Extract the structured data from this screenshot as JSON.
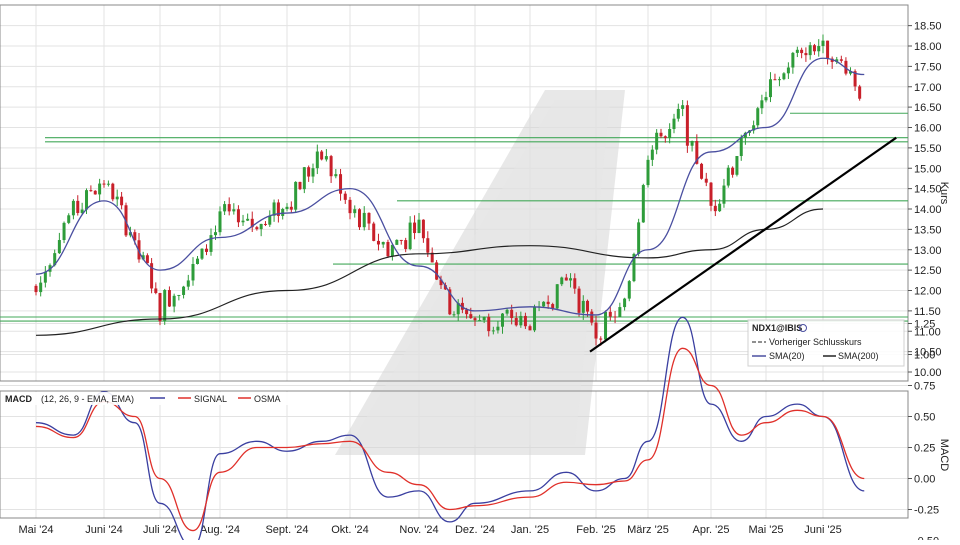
{
  "chart_data": [
    {
      "type": "candlestick",
      "ylabel": "Kurs",
      "ylim": [
        9.75,
        18.75
      ],
      "yticks": [
        "10.00",
        "10.50",
        "11.00",
        "11.50",
        "12.00",
        "12.50",
        "13.00",
        "13.50",
        "14.00",
        "14.50",
        "15.00",
        "15.50",
        "16.00",
        "16.50",
        "17.00",
        "17.50",
        "18.00",
        "18.50"
      ],
      "xticks": [
        "Mai '24",
        "Juni '24",
        "Juli '24",
        "Aug. '24",
        "Sept. '24",
        "Okt. '24",
        "Nov. '24",
        "Dez. '24",
        "Jan. '25",
        "Feb. '25",
        "März '25",
        "Apr. '25",
        "Mai '25",
        "Juni '25"
      ],
      "grid": true,
      "legend_position": "bottom-right",
      "legend": {
        "symbol": "NDX1@IBIS",
        "prev_close": "Vorheriger Schlusskurs",
        "sma20": "SMA(20)",
        "sma200": "SMA(200)"
      },
      "colors": {
        "up": "#2e9c3a",
        "down": "#c8202a",
        "sma20": "#4a4fa0",
        "sma200": "#222222",
        "levels": "#43a85a",
        "trendline": "#000000"
      },
      "horizontal_levels": [
        15.75,
        15.65,
        14.2,
        12.65,
        11.35,
        11.25,
        16.35
      ],
      "trendline": {
        "from": [
          "Feb. '25",
          10.5
        ],
        "to": [
          "Juni '25",
          15.75
        ]
      },
      "close_path": [
        [
          "Mai '24",
          12.1
        ],
        [
          "Mai '24",
          14.0
        ],
        [
          "Juni '24",
          14.7
        ],
        [
          "Juni '24",
          13.2
        ],
        [
          "Juli '24",
          11.6
        ],
        [
          "Juli '24",
          12.6
        ],
        [
          "Aug. '24",
          13.8
        ],
        [
          "Aug. '24",
          13.6
        ],
        [
          "Sept. '24",
          14.2
        ],
        [
          "Sept. '24",
          15.4
        ],
        [
          "Okt. '24",
          14.0
        ],
        [
          "Okt. '24",
          13.0
        ],
        [
          "Nov. '24",
          13.6
        ],
        [
          "Nov. '24",
          11.7
        ],
        [
          "Dez. '24",
          11.3
        ],
        [
          "Jan. '25",
          11.2
        ],
        [
          "Jan. '25",
          12.4
        ],
        [
          "Feb. '25",
          11.0
        ],
        [
          "Feb. '25",
          11.5
        ],
        [
          "März '25",
          15.5
        ],
        [
          "März '25",
          16.3
        ],
        [
          "Apr. '25",
          14.0
        ],
        [
          "Apr. '25",
          15.6
        ],
        [
          "Mai '25",
          16.8
        ],
        [
          "Mai '25",
          17.8
        ],
        [
          "Juni '25",
          18.1
        ],
        [
          "Juni '25",
          16.9
        ]
      ],
      "sma20_path": [
        [
          "Mai '24",
          12.4
        ],
        [
          "Juni '24",
          14.2
        ],
        [
          "Juli '24",
          12.5
        ],
        [
          "Aug. '24",
          13.3
        ],
        [
          "Sept. '24",
          13.9
        ],
        [
          "Okt. '24",
          14.5
        ],
        [
          "Nov. '24",
          12.6
        ],
        [
          "Dez. '24",
          11.5
        ],
        [
          "Jan. '25",
          11.6
        ],
        [
          "Feb. '25",
          11.4
        ],
        [
          "März '25",
          13.0
        ],
        [
          "Apr. '25",
          15.4
        ],
        [
          "Mai '25",
          16.0
        ],
        [
          "Juni '25",
          17.7
        ],
        [
          "Juni '25",
          17.3
        ]
      ],
      "sma200_path": [
        [
          "Mai '24",
          10.9
        ],
        [
          "Juli '24",
          11.3
        ],
        [
          "Sept. '24",
          12.0
        ],
        [
          "Nov. '24",
          12.9
        ],
        [
          "Jan. '25",
          13.1
        ],
        [
          "März '25",
          12.8
        ],
        [
          "Apr. '25",
          13.0
        ],
        [
          "Mai '25",
          13.5
        ],
        [
          "Juni '25",
          14.0
        ]
      ]
    },
    {
      "type": "line",
      "title": "MACD",
      "params": "(12, 26, 9 - EMA, EMA)",
      "ylabel": "MACD",
      "ylim": [
        -0.6,
        1.4
      ],
      "yticks": [
        "-0.50",
        "-0.25",
        "0.00",
        "0.25",
        "0.50",
        "0.75",
        "1.00",
        "1.25"
      ],
      "series": [
        {
          "name": "",
          "color": "#3a3fa0",
          "values": [
            [
              "Mai '24",
              0.45
            ],
            [
              "Mai '24",
              0.35
            ],
            [
              "Juni '24",
              0.7
            ],
            [
              "Juni '24",
              0.45
            ],
            [
              "Juli '24",
              -0.2
            ],
            [
              "Juli '24",
              -0.55
            ],
            [
              "Aug. '24",
              0.2
            ],
            [
              "Aug. '24",
              0.3
            ],
            [
              "Sept. '24",
              0.22
            ],
            [
              "Sept. '24",
              0.3
            ],
            [
              "Okt. '24",
              0.35
            ],
            [
              "Okt. '24",
              -0.15
            ],
            [
              "Nov. '24",
              -0.1
            ],
            [
              "Nov. '24",
              -0.35
            ],
            [
              "Dez. '24",
              -0.2
            ],
            [
              "Jan. '25",
              -0.1
            ],
            [
              "Jan. '25",
              0.05
            ],
            [
              "Feb. '25",
              -0.1
            ],
            [
              "Feb. '25",
              0.0
            ],
            [
              "März '25",
              0.3
            ],
            [
              "März '25",
              1.3
            ],
            [
              "Apr. '25",
              0.6
            ],
            [
              "Apr. '25",
              0.3
            ],
            [
              "Mai '25",
              0.5
            ],
            [
              "Mai '25",
              0.6
            ],
            [
              "Juni '25",
              0.5
            ],
            [
              "Juni '25",
              -0.1
            ]
          ]
        },
        {
          "name": "SIGNAL",
          "color": "#e0302a",
          "values": [
            [
              "Mai '24",
              0.42
            ],
            [
              "Mai '24",
              0.33
            ],
            [
              "Juni '24",
              0.62
            ],
            [
              "Juni '24",
              0.5
            ],
            [
              "Juli '24",
              0.0
            ],
            [
              "Juli '24",
              -0.42
            ],
            [
              "Aug. '24",
              0.05
            ],
            [
              "Aug. '24",
              0.25
            ],
            [
              "Sept. '24",
              0.25
            ],
            [
              "Sept. '24",
              0.28
            ],
            [
              "Okt. '24",
              0.3
            ],
            [
              "Okt. '24",
              0.05
            ],
            [
              "Nov. '24",
              -0.05
            ],
            [
              "Nov. '24",
              -0.25
            ],
            [
              "Dez. '24",
              -0.22
            ],
            [
              "Jan. '25",
              -0.15
            ],
            [
              "Jan. '25",
              -0.03
            ],
            [
              "Feb. '25",
              -0.05
            ],
            [
              "Feb. '25",
              -0.02
            ],
            [
              "März '25",
              0.15
            ],
            [
              "März '25",
              1.05
            ],
            [
              "Apr. '25",
              0.75
            ],
            [
              "Apr. '25",
              0.35
            ],
            [
              "Mai '25",
              0.45
            ],
            [
              "Mai '25",
              0.55
            ],
            [
              "Juni '25",
              0.5
            ],
            [
              "Juni '25",
              0.0
            ]
          ]
        }
      ],
      "legend": {
        "title": "MACD",
        "params": "(12, 26, 9 - EMA, EMA)",
        "signal": "SIGNAL",
        "osma": "OSMA"
      }
    }
  ]
}
